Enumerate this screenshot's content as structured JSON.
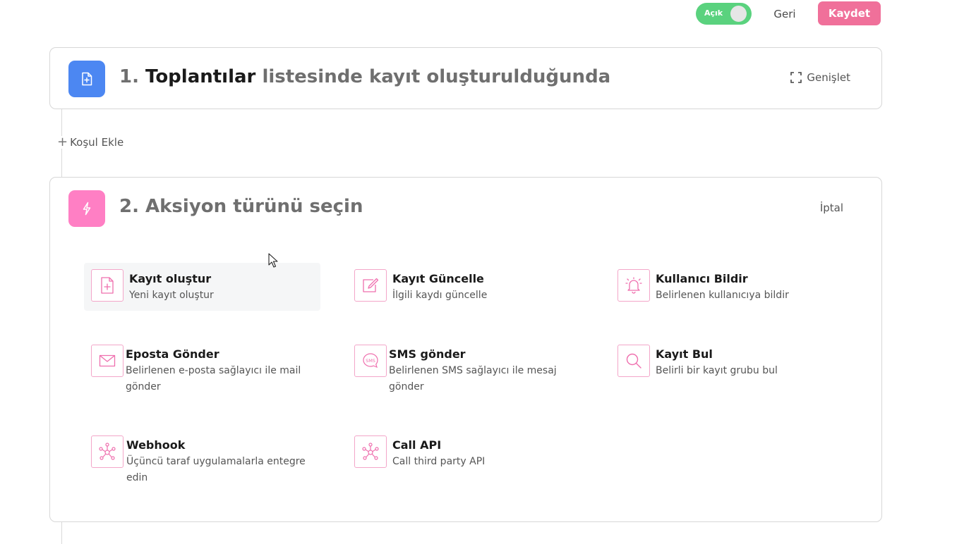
{
  "header": {
    "toggle_label": "Açık",
    "back_label": "Geri",
    "save_label": "Kaydet"
  },
  "trigger_card": {
    "step": "1.",
    "list_name": "Toplantılar",
    "title_rest": "listesinde kayıt oluşturulduğunda",
    "expand_label": "Genişlet"
  },
  "add_condition_label": "Koşul Ekle",
  "action_card": {
    "title": "2. Aksiyon türünü seçin",
    "cancel_label": "İptal",
    "options": [
      {
        "icon": "file-add-icon",
        "title": "Kayıt oluştur",
        "desc": "Yeni kayıt oluştur"
      },
      {
        "icon": "edit-icon",
        "title": "Kayıt Güncelle",
        "desc": "İlgili kaydı güncelle"
      },
      {
        "icon": "bell-icon",
        "title": "Kullanıcı Bildir",
        "desc": "Belirlenen kullanıcıya bildir"
      },
      {
        "icon": "mail-icon",
        "title": "Eposta Gönder",
        "desc": "Belirlenen e-posta sağlayıcı ile mail gönder"
      },
      {
        "icon": "sms-icon",
        "title": "SMS gönder",
        "desc": "Belirlenen SMS sağlayıcı ile mesaj gönder"
      },
      {
        "icon": "search-icon",
        "title": "Kayıt Bul",
        "desc": "Belirli bir kayıt grubu bul"
      },
      {
        "icon": "webhook-icon",
        "title": "Webhook",
        "desc": "Üçüncü taraf uygulamalarla entegre edin"
      },
      {
        "icon": "api-icon",
        "title": "Call API",
        "desc": "Call third party API"
      }
    ]
  },
  "colors": {
    "toggle_on": "#5ad27e",
    "save_button": "#f0709a",
    "trigger_badge": "#4c87f2",
    "action_badge": "#ff7fc4",
    "option_icon_stroke": "#ef6fae"
  }
}
